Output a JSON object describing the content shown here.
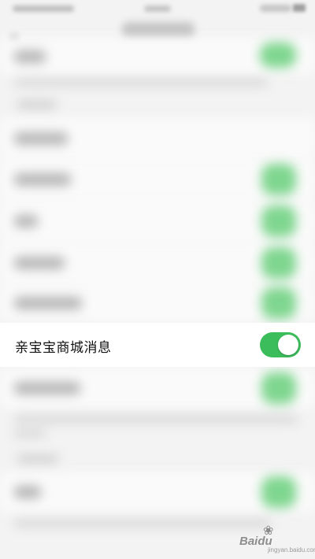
{
  "screen": {
    "focused_setting": {
      "label": "亲宝宝商城消息",
      "enabled": true
    },
    "colors": {
      "toggle_on": "#3cbd5b",
      "background": "#f3f3f3",
      "row_background": "#ffffff"
    }
  },
  "watermark": {
    "text": "Baidu",
    "subtext": "jingyan.baidu.com",
    "icon": "paw-icon"
  }
}
